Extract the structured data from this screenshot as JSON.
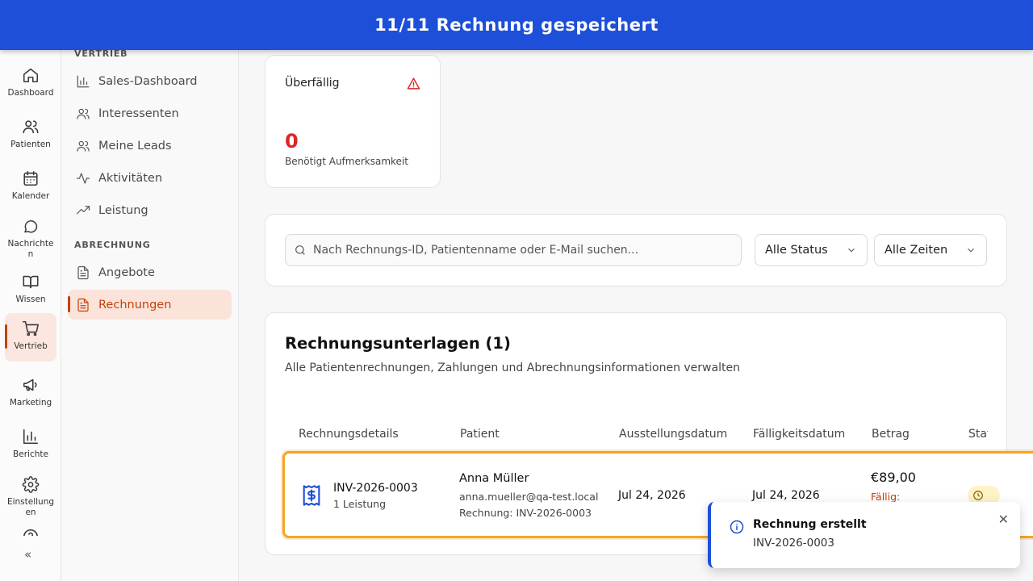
{
  "banner": {
    "text": "11/11 Rechnung gespeichert"
  },
  "rail": {
    "items": [
      {
        "label": "Dashboard",
        "icon": "home-icon"
      },
      {
        "label": "Patienten",
        "icon": "users-icon"
      },
      {
        "label": "Kalender",
        "icon": "calendar-icon"
      },
      {
        "label": "Nachrichten",
        "icon": "chat-icon"
      },
      {
        "label": "Wissen",
        "icon": "book-icon"
      },
      {
        "label": "Vertrieb",
        "icon": "cart-icon"
      },
      {
        "label": "Marketing",
        "icon": "megaphone-icon"
      },
      {
        "label": "Berichte",
        "icon": "bar-chart-icon"
      },
      {
        "label": "Einstellungen",
        "icon": "gear-icon"
      }
    ],
    "collapse": "«"
  },
  "subnav": {
    "section_sales": "VERTRIEB",
    "sales_items": [
      {
        "label": "Sales-Dashboard"
      },
      {
        "label": "Interessenten"
      },
      {
        "label": "Meine Leads"
      },
      {
        "label": "Aktivitäten"
      },
      {
        "label": "Leistung"
      }
    ],
    "section_billing": "ABRECHNUNG",
    "billing_items": [
      {
        "label": "Angebote"
      },
      {
        "label": "Rechnungen"
      }
    ]
  },
  "stat": {
    "title": "Überfällig",
    "value": "0",
    "subtitle": "Benötigt Aufmerksamkeit"
  },
  "filters": {
    "search_placeholder": "Nach Rechnungs-ID, Patientenname oder E-Mail suchen...",
    "status": "Alle Status",
    "time": "Alle Zeiten"
  },
  "invoices": {
    "title": "Rechnungsunterlagen (1)",
    "subtitle": "Alle Patientenrechnungen, Zahlungen und Abrechnungsinformationen verwalten",
    "columns": [
      "Rechnungsdetails",
      "Patient",
      "Ausstellungsdatum",
      "Fälligkeitsdatum",
      "Betrag",
      "Stat"
    ],
    "rows": [
      {
        "id": "INV-2026-0003",
        "items": "1 Leistung",
        "patient_name": "Anna Müller",
        "patient_email": "anna.mueller@qa-test.local",
        "patient_ref": "Rechnung: INV-2026-0003",
        "issue_date": "Jul 24, 2026",
        "due_date": "Jul 24, 2026",
        "amount": "€89,00",
        "amount_note": "Fällig:"
      }
    ]
  },
  "toast": {
    "title": "Rechnung erstellt",
    "body": "INV-2026-0003"
  },
  "colors": {
    "brand": "#1d4fd8",
    "accent": "#c2410c",
    "danger": "#dc2626",
    "highlight": "#f5a524"
  }
}
